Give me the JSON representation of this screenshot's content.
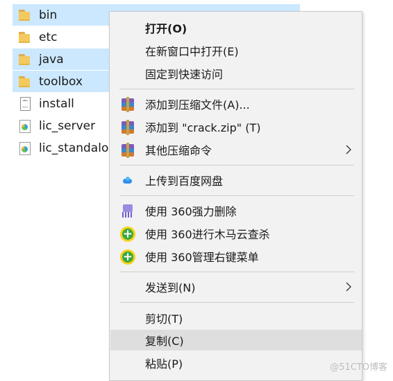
{
  "files": [
    {
      "name": "bin",
      "icon": "folder-icon",
      "selected": true
    },
    {
      "name": "etc",
      "icon": "folder-icon",
      "selected": false
    },
    {
      "name": "java",
      "icon": "folder-icon",
      "selected": true
    },
    {
      "name": "toolbox",
      "icon": "folder-icon",
      "selected": true
    },
    {
      "name": "install",
      "icon": "document-icon",
      "selected": false
    },
    {
      "name": "lic_server",
      "icon": "app-icon",
      "selected": false
    },
    {
      "name": "lic_standalo",
      "icon": "app-icon",
      "selected": false
    }
  ],
  "menu": {
    "open": "打开(O)",
    "open_new_window": "在新窗口中打开(E)",
    "pin_quick_access": "固定到快速访问",
    "add_to_archive": "添加到压缩文件(A)...",
    "add_to_zip": "添加到 \"crack.zip\" (T)",
    "other_compress": "其他压缩命令",
    "upload_baidu": "上传到百度网盘",
    "shred_360": "使用 360强力删除",
    "scan_360": "使用 360进行木马云查杀",
    "manage_360": "使用 360管理右键菜单",
    "send_to": "发送到(N)",
    "cut": "剪切(T)",
    "copy": "复制(C)",
    "paste": "粘贴(P)"
  },
  "watermark": "@51CTO博客",
  "colors": {
    "selection": "#cce8ff",
    "menu_bg": "#f2f2f2",
    "menu_hover": "#dedede"
  }
}
